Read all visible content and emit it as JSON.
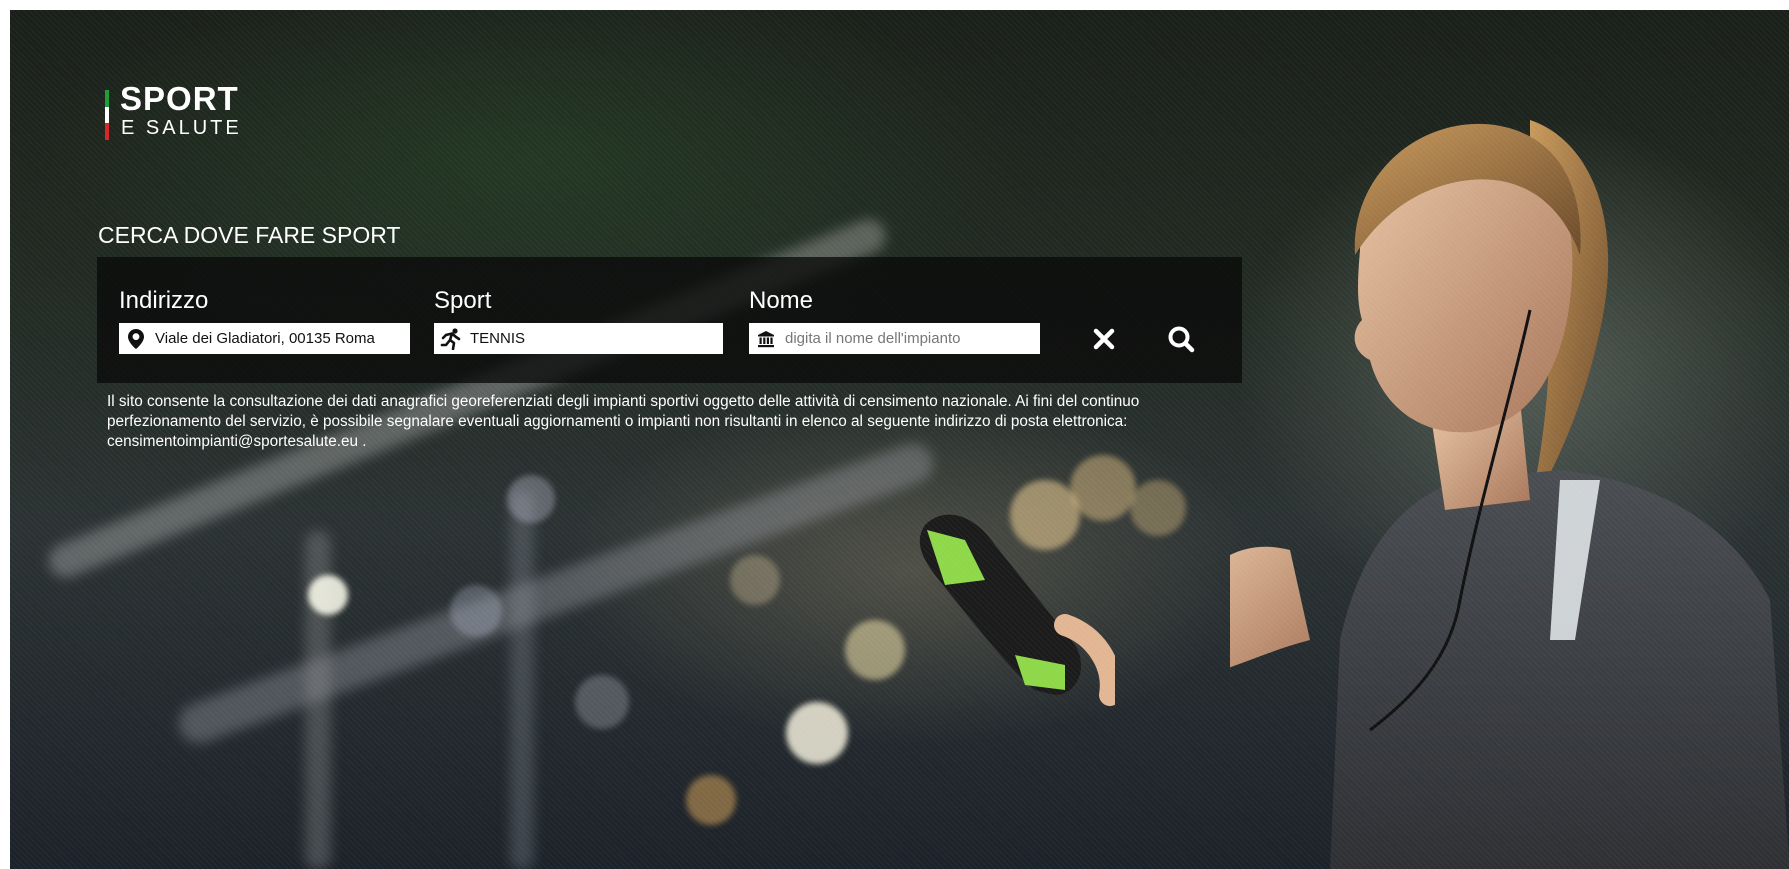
{
  "logo": {
    "line1": "SPORT",
    "line2": "E SALUTE",
    "flag_colors": [
      "#1f9d3a",
      "#ffffff",
      "#d8262b"
    ]
  },
  "search": {
    "title": "CERCA DOVE FARE SPORT",
    "address": {
      "label": "Indirizzo",
      "value": "Viale dei Gladiatori, 00135 Roma",
      "icon": "map-marker-icon"
    },
    "sport": {
      "label": "Sport",
      "value": "TENNIS",
      "icon": "running-person-icon"
    },
    "name": {
      "label": "Nome",
      "value": "",
      "placeholder": "digita il nome dell'impianto",
      "icon": "institution-building-icon"
    },
    "clear_icon": "close-icon",
    "search_icon": "search-icon"
  },
  "info": {
    "text": "Il sito consente la consultazione dei dati anagrafici georeferenziati degli impianti sportivi oggetto delle attività di censimento nazionale. Ai fini del continuo perfezionamento del servizio, è possibile segnalare eventuali aggiornamenti o impianti non risultanti in elenco al seguente indirizzo di posta elettronica: censimentoimpianti@sportesalute.eu ."
  },
  "colors": {
    "accent_green": "#8ed84a",
    "panel": "#0a0a0a"
  }
}
